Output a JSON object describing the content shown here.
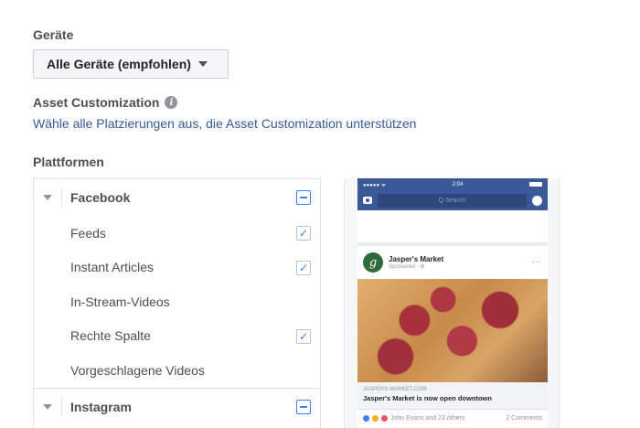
{
  "devices": {
    "label": "Geräte",
    "selected": "Alle Geräte (empfohlen)"
  },
  "asset_customization": {
    "label": "Asset Customization",
    "info_icon": "info-icon",
    "link_text": "Wähle alle Platzierungen aus, die Asset Customization unterstützen"
  },
  "platforms": {
    "label": "Plattformen",
    "groups": [
      {
        "name": "Facebook",
        "items": [
          {
            "label": "Feeds",
            "checked": true
          },
          {
            "label": "Instant Articles",
            "checked": true
          },
          {
            "label": "In-Stream-Videos",
            "checked": false
          },
          {
            "label": "Rechte Spalte",
            "checked": true
          },
          {
            "label": "Vorgeschlagene Videos",
            "checked": false
          }
        ]
      },
      {
        "name": "Instagram",
        "items": []
      }
    ]
  },
  "preview": {
    "time": "2:04",
    "signal": "●●●●● ᯤ",
    "search_placeholder": "Q  Search",
    "page_name": "Jasper's Market",
    "sponsored": "Sponsored · ⚙",
    "more": "···",
    "logo_letter": "g",
    "domain": "JASPERS-MARKET.COM",
    "headline": "Jasper's Market is now open downtown",
    "reactions": "John Evans and 23 others",
    "comments": "2 Comments"
  },
  "colors": {
    "accent": "#4080ff",
    "link": "#365899",
    "facebook_blue": "#3b5998"
  }
}
